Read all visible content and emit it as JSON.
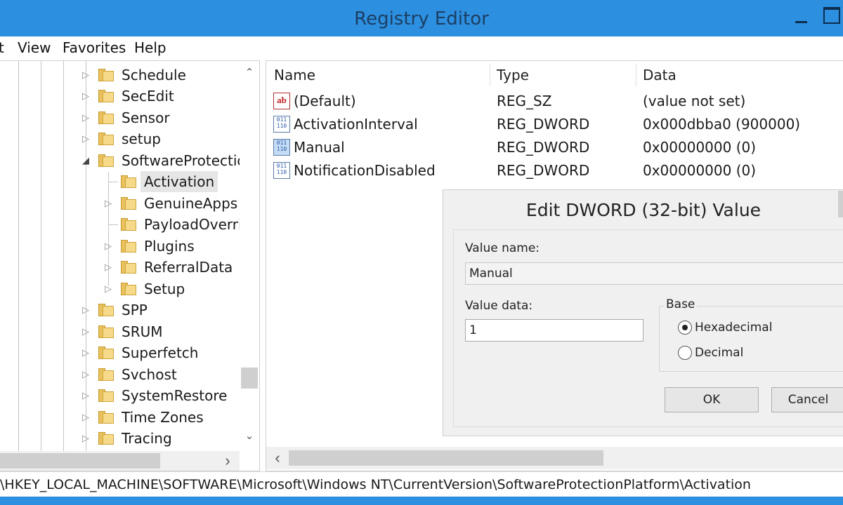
{
  "window": {
    "title": "Registry Editor"
  },
  "menu": {
    "items": [
      "t",
      "View",
      "Favorites",
      "Help"
    ]
  },
  "tree": {
    "items": [
      {
        "label": "Schedule"
      },
      {
        "label": "SecEdit"
      },
      {
        "label": "Sensor"
      },
      {
        "label": "setup"
      },
      {
        "label": "SoftwareProtectionPlatform",
        "expanded": true
      },
      {
        "label": "Activation",
        "selected": true
      },
      {
        "label": "GenuineApps"
      },
      {
        "label": "PayloadOverrides"
      },
      {
        "label": "Plugins"
      },
      {
        "label": "ReferralData"
      },
      {
        "label": "Setup"
      },
      {
        "label": "SPP"
      },
      {
        "label": "SRUM"
      },
      {
        "label": "Superfetch"
      },
      {
        "label": "Svchost"
      },
      {
        "label": "SystemRestore"
      },
      {
        "label": "Time Zones"
      },
      {
        "label": "Tracing"
      }
    ],
    "scroll_up": "⌃",
    "scroll_down": "⌄",
    "scroll_right": "›"
  },
  "list": {
    "columns": {
      "name": "Name",
      "type": "Type",
      "data": "Data"
    },
    "rows": [
      {
        "icon": "ab",
        "name": "(Default)",
        "type": "REG_SZ",
        "data": "(value not set)"
      },
      {
        "icon": "011\n110",
        "name": "ActivationInterval",
        "type": "REG_DWORD",
        "data": "0x000dbba0 (900000)"
      },
      {
        "icon": "011\n110",
        "name": "Manual",
        "type": "REG_DWORD",
        "data": "0x00000000 (0)"
      },
      {
        "icon": "011\n110",
        "name": "NotificationDisabled",
        "type": "REG_DWORD",
        "data": "0x00000000 (0)"
      }
    ],
    "scroll_left": "‹"
  },
  "dialog": {
    "title": "Edit DWORD (32-bit) Value",
    "value_name_label": "Value name:",
    "value_name": "Manual",
    "value_data_label": "Value data:",
    "value_data": "1",
    "base_label": "Base",
    "base_options": [
      "Hexadecimal",
      "Decimal"
    ],
    "selected_base": "Hexadecimal",
    "ok_label": "OK",
    "cancel_label": "Cancel"
  },
  "status": {
    "path": "\\HKEY_LOCAL_MACHINE\\SOFTWARE\\Microsoft\\Windows NT\\CurrentVersion\\SoftwareProtectionPlatform\\Activation"
  },
  "colors": {
    "titlebar": "#2d8fe0",
    "selected_row": "#e6e6e6",
    "folder": "#f6da8a"
  }
}
